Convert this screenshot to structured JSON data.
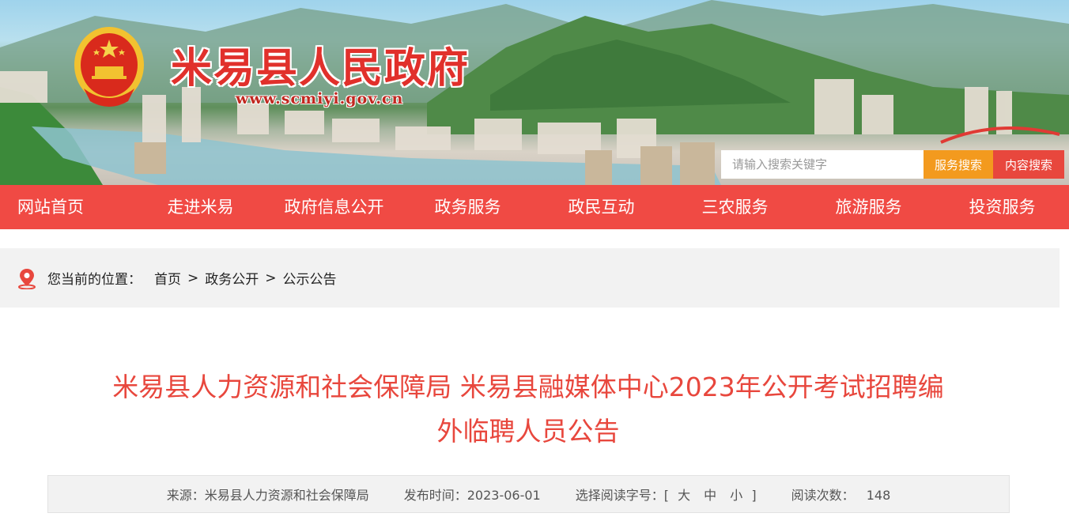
{
  "header": {
    "site_title": "米易县人民政府",
    "site_url": "www.scmiyi.gov.cn",
    "emblem_icon": "national-emblem-icon"
  },
  "search": {
    "placeholder": "请输入搜索关键字",
    "service_button": "服务搜索",
    "content_button": "内容搜索"
  },
  "nav": {
    "items": [
      "网站首页",
      "走进米易",
      "政府信息公开",
      "政务服务",
      "政民互动",
      "三农服务",
      "旅游服务",
      "投资服务"
    ]
  },
  "breadcrumb": {
    "label": "您当前的位置：",
    "items": [
      "首页",
      "政务公开",
      "公示公告"
    ],
    "separator": ">",
    "icon": "location-pin-icon"
  },
  "article": {
    "title_line1": "米易县人力资源和社会保障局 米易县融媒体中心2023年公开考试招聘编",
    "title_line2": "外临聘人员公告"
  },
  "meta": {
    "source": "来源：米易县人力资源和社会保障局",
    "publish": "发布时间：2023-06-01",
    "font_label": "选择阅读字号：[",
    "font_large": "大",
    "font_medium": "中",
    "font_small": "小",
    "font_close": "]",
    "views_label": "阅读次数：",
    "views": "148"
  },
  "colors": {
    "nav_bg": "#f04a44",
    "title_red": "#e8473d",
    "service_btn": "#f39a1e",
    "content_btn": "#e8473d"
  }
}
